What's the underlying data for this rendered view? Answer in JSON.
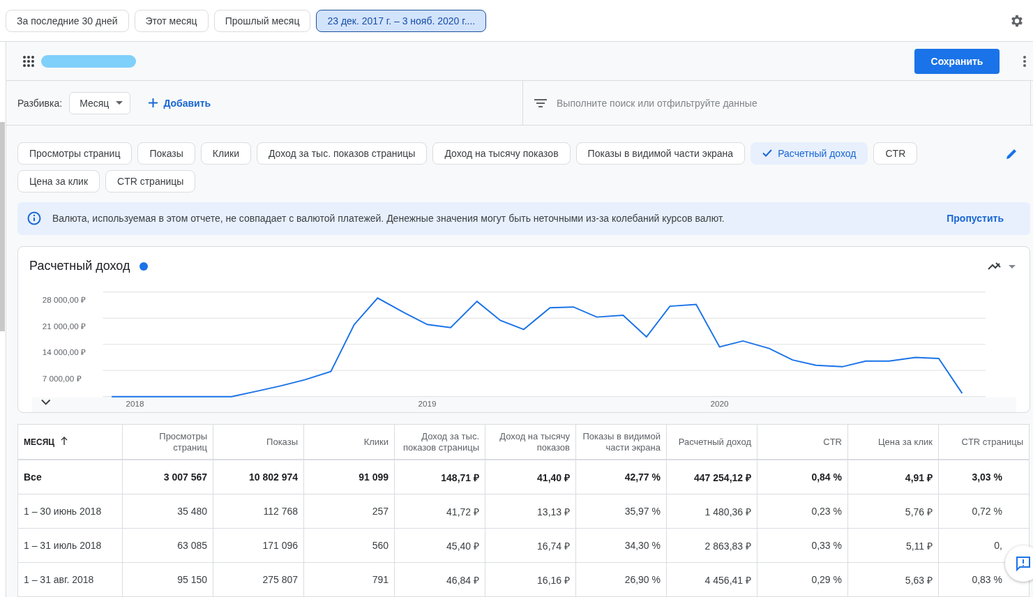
{
  "date_ranges": [
    {
      "label": "За последние 30 дней",
      "selected": false
    },
    {
      "label": "Этот месяц",
      "selected": false
    },
    {
      "label": "Прошлый месяц",
      "selected": false
    },
    {
      "label": "23 дек. 2017 г. – 3 нояб. 2020 г....",
      "selected": true
    }
  ],
  "toolbar": {
    "save_button": "Сохранить"
  },
  "breakdown": {
    "label": "Разбивка:",
    "value": "Месяц",
    "add_button": "Добавить"
  },
  "search": {
    "placeholder": "Выполните поиск или отфильтруйте данные"
  },
  "metrics": [
    {
      "label": "Просмотры страниц",
      "selected": false
    },
    {
      "label": "Показы",
      "selected": false
    },
    {
      "label": "Клики",
      "selected": false
    },
    {
      "label": "Доход за тыс. показов страницы",
      "selected": false
    },
    {
      "label": "Доход на тысячу показов",
      "selected": false
    },
    {
      "label": "Показы в видимой части экрана",
      "selected": false
    },
    {
      "label": "Расчетный доход",
      "selected": true
    },
    {
      "label": "CTR",
      "selected": false
    },
    {
      "label": "Цена за клик",
      "selected": false
    },
    {
      "label": "CTR страницы",
      "selected": false
    }
  ],
  "notice": {
    "text": "Валюта, используемая в этом отчете, не совпадает с валютой платежей. Денежные значения могут быть неточными из-за колебаний курсов валют.",
    "action": "Пропустить"
  },
  "chart": {
    "chart_data": {
      "type": "line",
      "title": "Расчетный доход",
      "x": [
        2017.92,
        2018.0,
        2018.08,
        2018.17,
        2018.25,
        2018.33,
        2018.42,
        2018.5,
        2018.58,
        2018.67,
        2018.75,
        2018.83,
        2018.92,
        2019.0,
        2019.08,
        2019.17,
        2019.25,
        2019.33,
        2019.42,
        2019.5,
        2019.58,
        2019.67,
        2019.75,
        2019.83,
        2019.92,
        2020.0,
        2020.08,
        2020.17,
        2020.25,
        2020.33,
        2020.42,
        2020.5,
        2020.58,
        2020.67,
        2020.75,
        2020.83
      ],
      "series": [
        {
          "color": "#1a73e8",
          "values": [
            0,
            0,
            0,
            0,
            0,
            0,
            1500,
            2900,
            4500,
            6700,
            19300,
            26400,
            22500,
            19300,
            18500,
            25500,
            20400,
            18000,
            23800,
            24000,
            21300,
            21800,
            16000,
            24200,
            24700,
            13300,
            14900,
            12900,
            9800,
            8400,
            8000,
            9500,
            9500,
            10500,
            10200,
            900
          ]
        }
      ],
      "ylim": [
        0,
        28000
      ],
      "yticks": [
        {
          "value": 7000,
          "label": "7 000,00 ₽"
        },
        {
          "value": 14000,
          "label": "14 000,00 ₽"
        },
        {
          "value": 21000,
          "label": "21 000,00 ₽"
        },
        {
          "value": 28000,
          "label": "28 000,00 ₽"
        }
      ],
      "xlim": [
        2017.89,
        2020.91
      ],
      "xticks": [
        2018,
        2019,
        2020
      ],
      "grid": true
    }
  },
  "table": {
    "columns": [
      {
        "label": "МЕСЯЦ",
        "sorted": true
      },
      {
        "label": "Просмотры страниц"
      },
      {
        "label": "Показы"
      },
      {
        "label": "Клики"
      },
      {
        "label": "Доход за тыс. показов страницы"
      },
      {
        "label": "Доход на тысячу показов"
      },
      {
        "label": "Показы в видимой части экрана"
      },
      {
        "label": "Расчетный доход"
      },
      {
        "label": "CTR"
      },
      {
        "label": "Цена за клик"
      },
      {
        "label": "CTR страницы"
      }
    ],
    "rows": [
      {
        "kind": "total",
        "cells": [
          "Все",
          "3 007 567",
          "10 802 974",
          "91 099",
          "148,71 ₽",
          "41,40 ₽",
          "42,77 %",
          "447 254,12 ₽",
          "0,84 %",
          "4,91 ₽",
          "3,03 %"
        ]
      },
      {
        "kind": "month",
        "cells": [
          "1 – 30 июнь 2018",
          "35 480",
          "112 768",
          "257",
          "41,72 ₽",
          "13,13 ₽",
          "35,97 %",
          "1 480,36 ₽",
          "0,23 %",
          "5,76 ₽",
          "0,72 %"
        ]
      },
      {
        "kind": "month",
        "cells": [
          "1 – 31 июль 2018",
          "63 085",
          "171 096",
          "560",
          "45,40 ₽",
          "16,74 ₽",
          "34,30 %",
          "2 863,83 ₽",
          "0,33 %",
          "5,11 ₽",
          "0,"
        ]
      },
      {
        "kind": "month",
        "cells": [
          "1 – 31 авг. 2018",
          "95 150",
          "275 807",
          "791",
          "46,84 ₽",
          "16,16 ₽",
          "26,90 %",
          "4 456,41 ₽",
          "0,29 %",
          "5,63 ₽",
          "0,83 %"
        ]
      }
    ]
  }
}
